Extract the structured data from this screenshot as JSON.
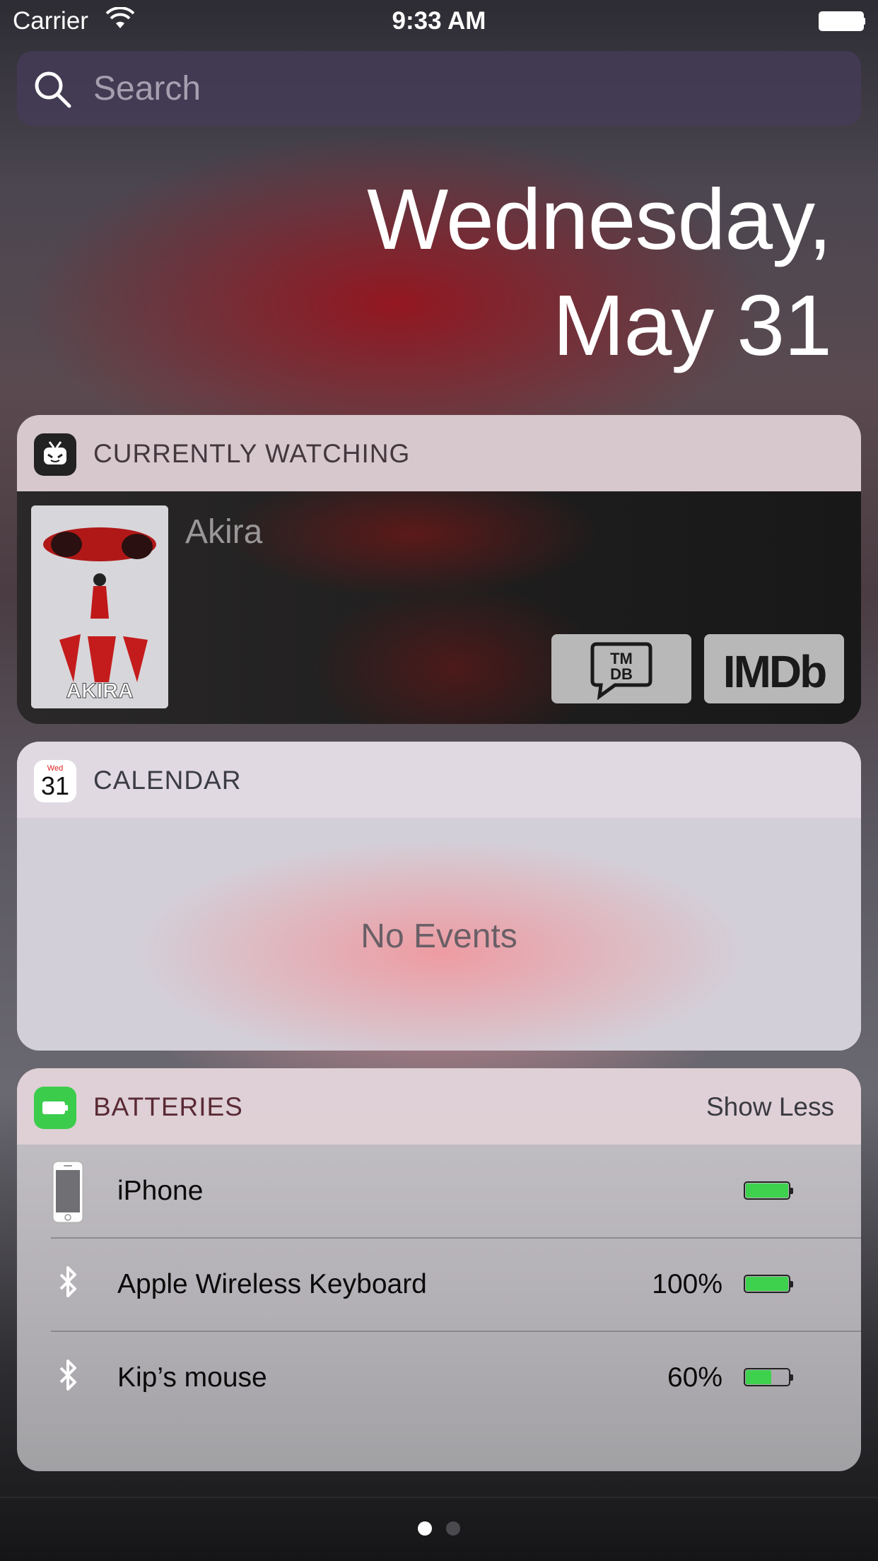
{
  "status_bar": {
    "carrier": "Carrier",
    "time": "9:33 AM"
  },
  "search": {
    "placeholder": "Search"
  },
  "date": {
    "line1": "Wednesday,",
    "line2": "May 31"
  },
  "currently_watching": {
    "title": "CURRENTLY WATCHING",
    "movie_title": "Akira",
    "tmdb_label_top": "TM",
    "tmdb_label_bottom": "DB",
    "imdb_label": "IMDb",
    "poster_text": "AKIRA"
  },
  "calendar": {
    "title": "CALENDAR",
    "icon_weekday": "Wed",
    "icon_day": "31",
    "empty_text": "No Events"
  },
  "batteries": {
    "title": "BATTERIES",
    "toggle_label": "Show Less",
    "devices": [
      {
        "name": "iPhone",
        "percent": "",
        "level": 1.0,
        "icon": "iphone-icon"
      },
      {
        "name": "Apple Wireless Keyboard",
        "percent": "100%",
        "level": 1.0,
        "icon": "bluetooth-icon"
      },
      {
        "name": "Kip’s mouse",
        "percent": "60%",
        "level": 0.6,
        "icon": "bluetooth-icon"
      }
    ]
  },
  "page_indicator": {
    "pages": 2,
    "current": 1
  },
  "colors": {
    "battery_green": "#3ed14e",
    "calendar_red": "#e02020"
  }
}
